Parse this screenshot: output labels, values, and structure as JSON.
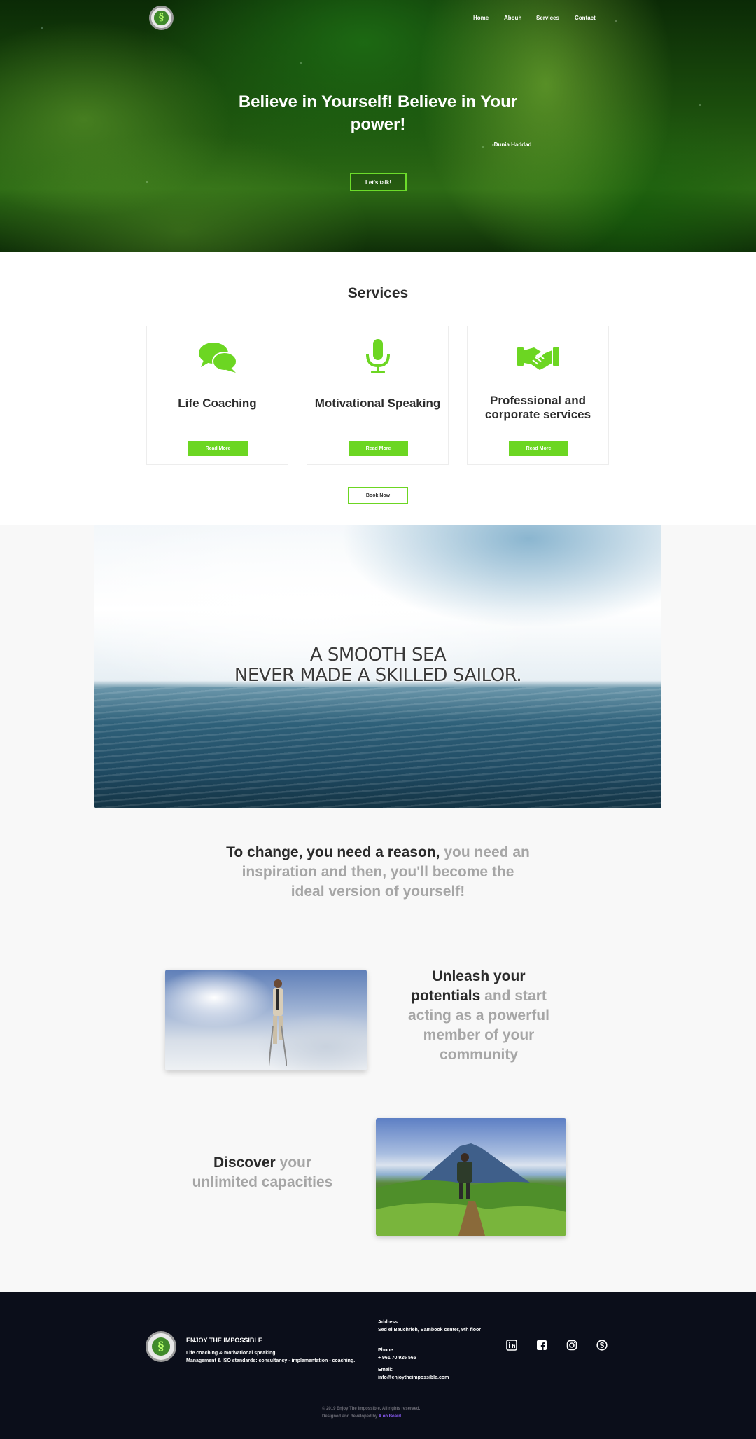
{
  "header": {
    "nav": [
      {
        "label": "Home"
      },
      {
        "label": "Abouh"
      },
      {
        "label": "Services"
      },
      {
        "label": "Contact"
      }
    ]
  },
  "hero": {
    "title": "Believe in Yourself! Believe in Your power!",
    "author": "-Dunia Haddad",
    "cta": "Let's talk!"
  },
  "services": {
    "title": "Services",
    "cards": [
      {
        "title": "Life Coaching",
        "icon": "chat-bubbles-icon",
        "button": "Read More"
      },
      {
        "title": "Motivational Speaking",
        "icon": "microphone-icon",
        "button": "Read More"
      },
      {
        "title": "Professional and corporate services",
        "icon": "handshake-icon",
        "button": "Read More"
      }
    ],
    "book_button": "Book Now"
  },
  "banner": {
    "line1": "A SMOOTH SEA",
    "line2": "NEVER MADE A SKILLED SAILOR."
  },
  "change": {
    "strong": "To change, you need a reason,",
    "muted": "you need an inspiration and then, you'll become the ideal version of yourself!"
  },
  "features": [
    {
      "strong": "Unleash your potentials",
      "muted": "and start acting as a powerful member of your community"
    },
    {
      "strong": "Discover",
      "muted": "your unlimited capacities"
    }
  ],
  "footer": {
    "brand": "ENJOY THE IMPOSSIBLE",
    "desc1": "Life coaching & motivational speaking.",
    "desc2": "Management & ISO standards: consultancy - implementation - coaching.",
    "address_label": "Address:",
    "address": "Sed el Bauchrieh, Bambook center, 9th floor",
    "phone_label": "Phone:",
    "phone": "+ 961 70 925 565",
    "email_label": "Email:",
    "email": "info@enjoytheimpossible.com",
    "social": [
      "linkedin-icon",
      "facebook-icon",
      "instagram-icon",
      "skype-icon"
    ],
    "copyright": "© 2019 Enjoy The Impossible. All rights reserved.",
    "credit_prefix": "Designed and developed by",
    "credit_brand": "X on Board"
  },
  "colors": {
    "accent": "#6cd622",
    "footer_bg": "#0b0e1a"
  }
}
